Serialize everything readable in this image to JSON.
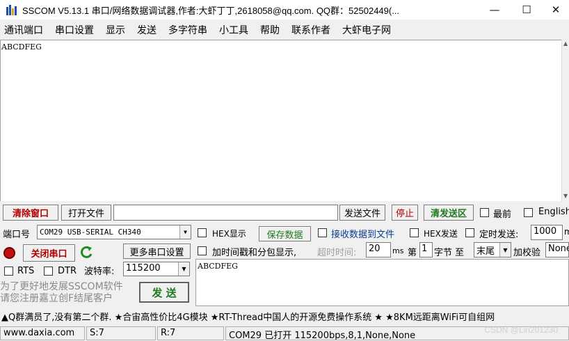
{
  "window": {
    "title": "SSCOM V5.13.1 串口/网络数据调试器,作者:大虾丁丁,2618058@qq.com. QQ群：52502449(...",
    "minimize": "—",
    "maximize": "☐",
    "close": "✕"
  },
  "menu": [
    "通讯端口",
    "串口设置",
    "显示",
    "发送",
    "多字符串",
    "小工具",
    "帮助",
    "联系作者",
    "大虾电子网"
  ],
  "receive": {
    "text": "ABCDFEG"
  },
  "toolbar": {
    "clear_window": "清除窗口",
    "open_file": "打开文件",
    "file_path": "",
    "send_file": "发送文件",
    "stop": "停止",
    "clear_send": "清发送区",
    "front_most": "最前",
    "english": "English"
  },
  "port": {
    "label": "端口号",
    "value": "COM29 USB-SERIAL CH340",
    "close_port": "关闭串口",
    "more_settings": "更多串口设置",
    "rts": "RTS",
    "dtr": "DTR",
    "baud_label": "波特率:",
    "baud_value": "115200"
  },
  "options": {
    "hex_display": "HEX显示",
    "save_data": "保存数据",
    "recv_to_file": "接收数据到文件",
    "hex_send": "HEX发送",
    "timed_send": "定时发送:",
    "timed_value": "1000",
    "timed_unit": "m",
    "timestamp": "加时间戳和分包显示,",
    "timeout_label": "超时时间:",
    "timeout_value": "20",
    "ms": "ms",
    "byte_pre": "第",
    "byte_from": "1",
    "byte_mid": "字节 至",
    "byte_to": "末尾",
    "checksum": "加校验",
    "checksum_value": "None"
  },
  "promo_left": "为了更好地发展SSCOM软件\n请您注册嘉立创F结尾客户",
  "send_button": "发 送",
  "send": {
    "text": "ABCDFEG"
  },
  "ticker": "▲Q群满员了,没有第二个群. ★合宙高性价比4G模块 ★RT-Thread中国人的开源免费操作系统 ★ ★8KM远距离WiFi可自组网",
  "status": {
    "site": "www.daxia.com",
    "sent": "S:7",
    "received": "R:7",
    "port_info": "COM29 已打开  115200bps,8,1,None,None",
    "watermark": "CSDN @Lin201230"
  }
}
